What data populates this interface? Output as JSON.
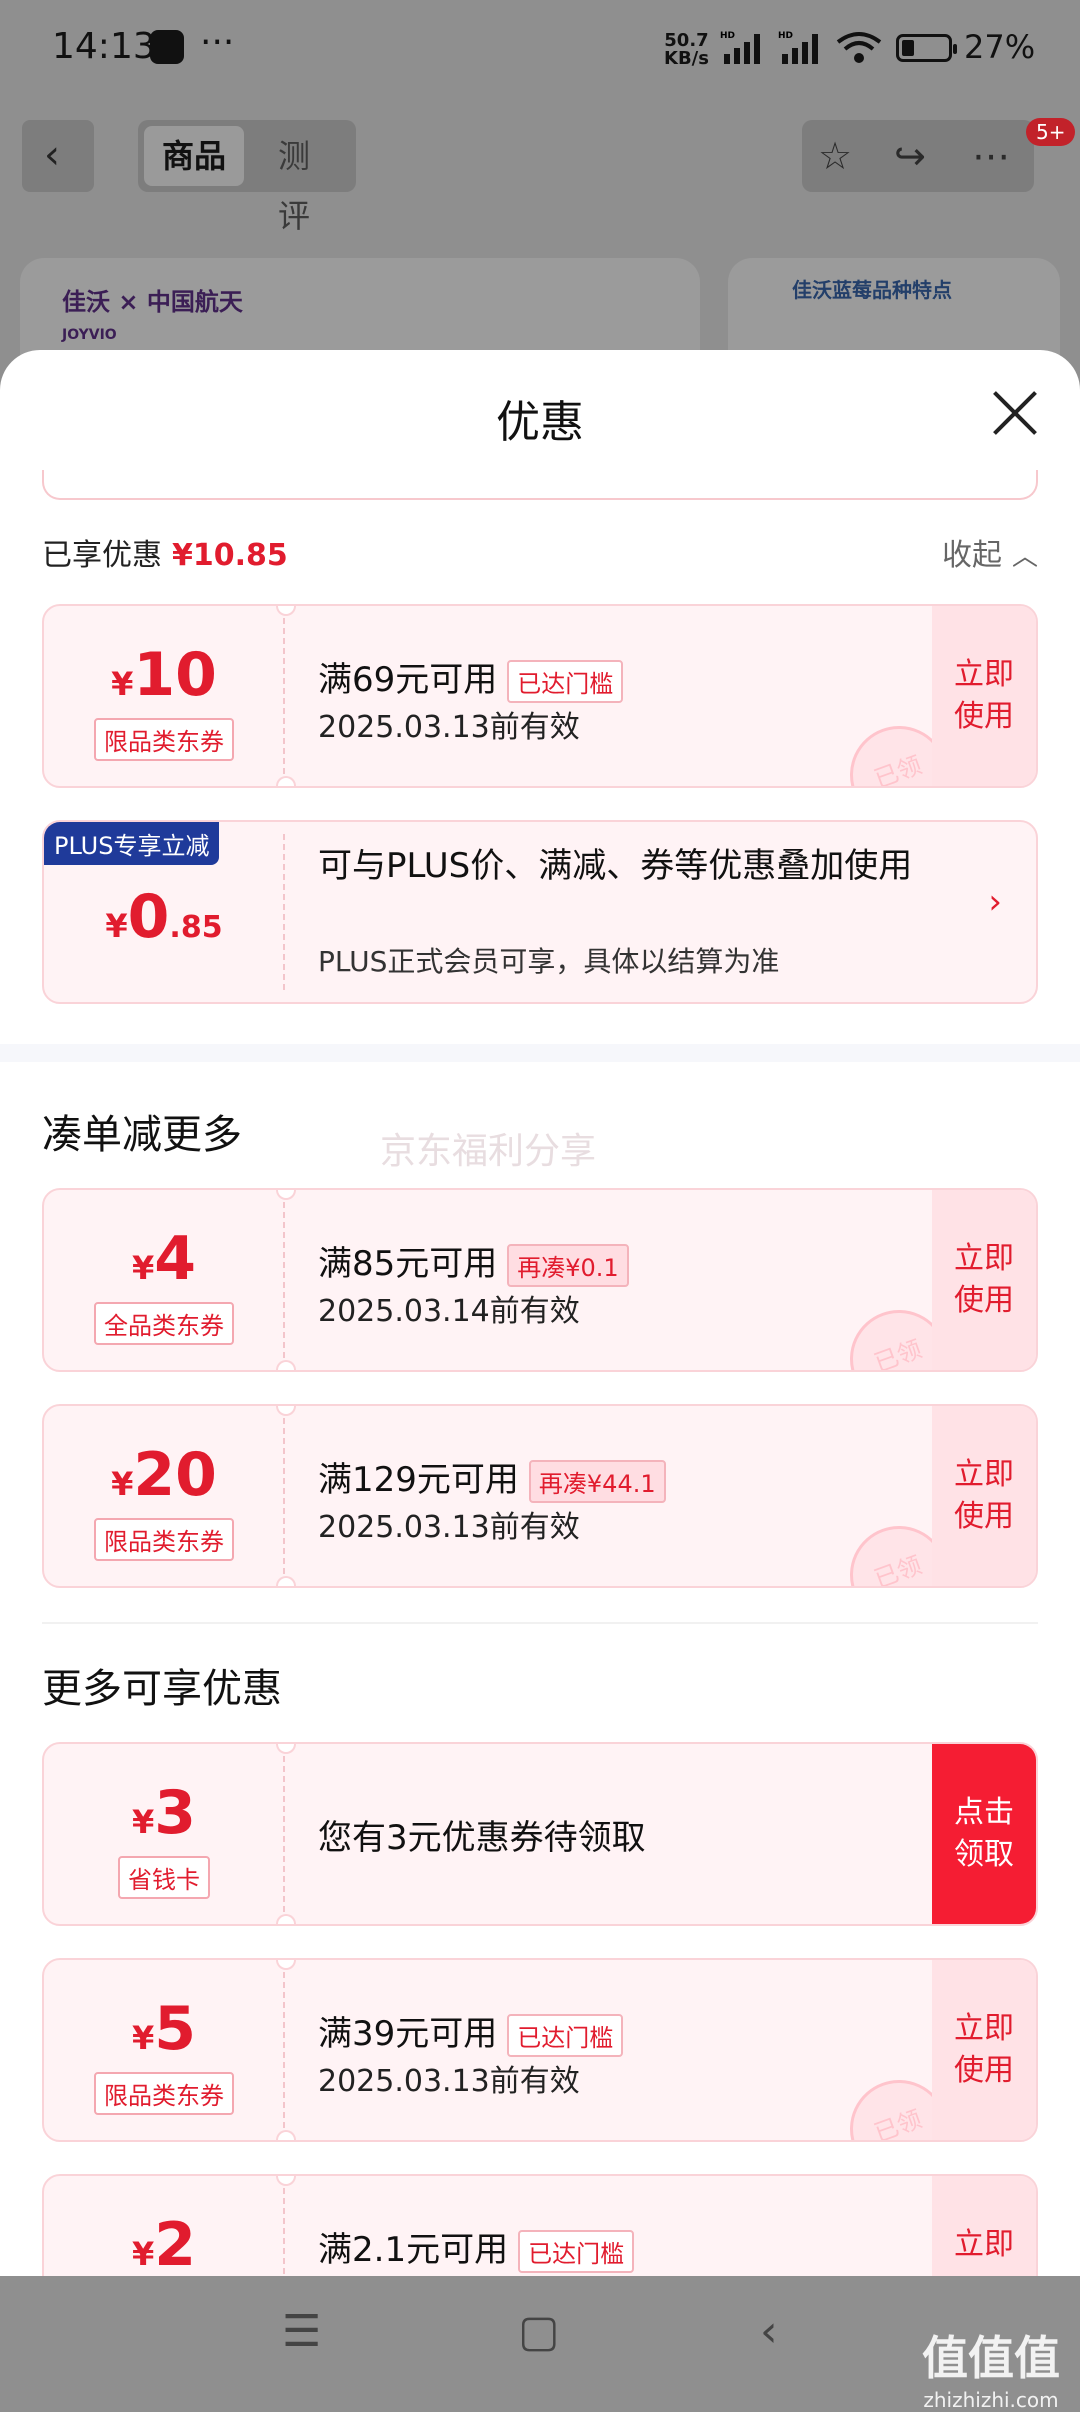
{
  "status_bar": {
    "time": "14:13",
    "dots": "···",
    "net_speed_line1": "50.7",
    "net_speed_line2": "KB/s",
    "hd1": "HD",
    "hd2": "HD",
    "battery": "27%"
  },
  "background_page": {
    "back": "‹",
    "tabs": [
      "商品",
      "测评"
    ],
    "badge": "5+",
    "brand": "佳沃 × 中国航天",
    "brand_sub": "JOYVIO",
    "card_title": "佳沃蓝莓品种特点",
    "action_icons": [
      "star-icon",
      "share-icon",
      "more-icon"
    ]
  },
  "sheet": {
    "title": "优惠",
    "enjoyed_label": "已享优惠",
    "enjoyed_amount": "¥10.85",
    "collapse": "收起",
    "applied": [
      {
        "yen": "¥",
        "amount": "10",
        "tag": "限品类东券",
        "condition": "满69元可用",
        "cond_tag": "已达门槛",
        "date": "2025.03.13前有效",
        "action": "立即使用",
        "action_line1": "立即",
        "action_line2": "使用",
        "stamp": "已领"
      }
    ],
    "plus": {
      "badge": "PLUS专享立减",
      "yen": "¥",
      "amount_int": "0",
      "amount_dec": ".85",
      "desc1": "可与PLUS价、满减、券等优惠叠加使用",
      "desc2": "PLUS正式会员可享，具体以结算为准"
    },
    "section1_title": "凑单减更多",
    "watermark": "京东福利分享",
    "section1": [
      {
        "yen": "¥",
        "amount": "4",
        "tag": "全品类东券",
        "condition": "满85元可用",
        "cond_tag": "再凑¥0.1",
        "date": "2025.03.14前有效",
        "action_line1": "立即",
        "action_line2": "使用",
        "stamp": "已领"
      },
      {
        "yen": "¥",
        "amount": "20",
        "tag": "限品类东券",
        "condition": "满129元可用",
        "cond_tag": "再凑¥44.1",
        "date": "2025.03.13前有效",
        "action_line1": "立即",
        "action_line2": "使用",
        "stamp": "已领"
      }
    ],
    "section2_title": "更多可享优惠",
    "section2": [
      {
        "yen": "¥",
        "amount": "3",
        "tag": "省钱卡",
        "text": "您有3元优惠券待领取",
        "action_line1": "点击",
        "action_line2": "领取"
      },
      {
        "yen": "¥",
        "amount": "5",
        "tag": "限品类东券",
        "condition": "满39元可用",
        "cond_tag": "已达门槛",
        "date": "2025.03.13前有效",
        "action_line1": "立即",
        "action_line2": "使用",
        "stamp": "已领"
      },
      {
        "yen": "¥",
        "amount": "2",
        "condition": "满2.1元可用",
        "cond_tag": "已达门槛",
        "action_line1": "立即"
      }
    ]
  },
  "nav_bar": {
    "menu": "☰",
    "home": "▢",
    "back": "‹"
  },
  "site_watermark": {
    "logo": "值值值",
    "url": "zhizhizhi.com"
  },
  "colors": {
    "accent_red": "#e11c2e",
    "coupon_bg": "#fff3f5",
    "plus_blue": "#1f3a9a"
  }
}
